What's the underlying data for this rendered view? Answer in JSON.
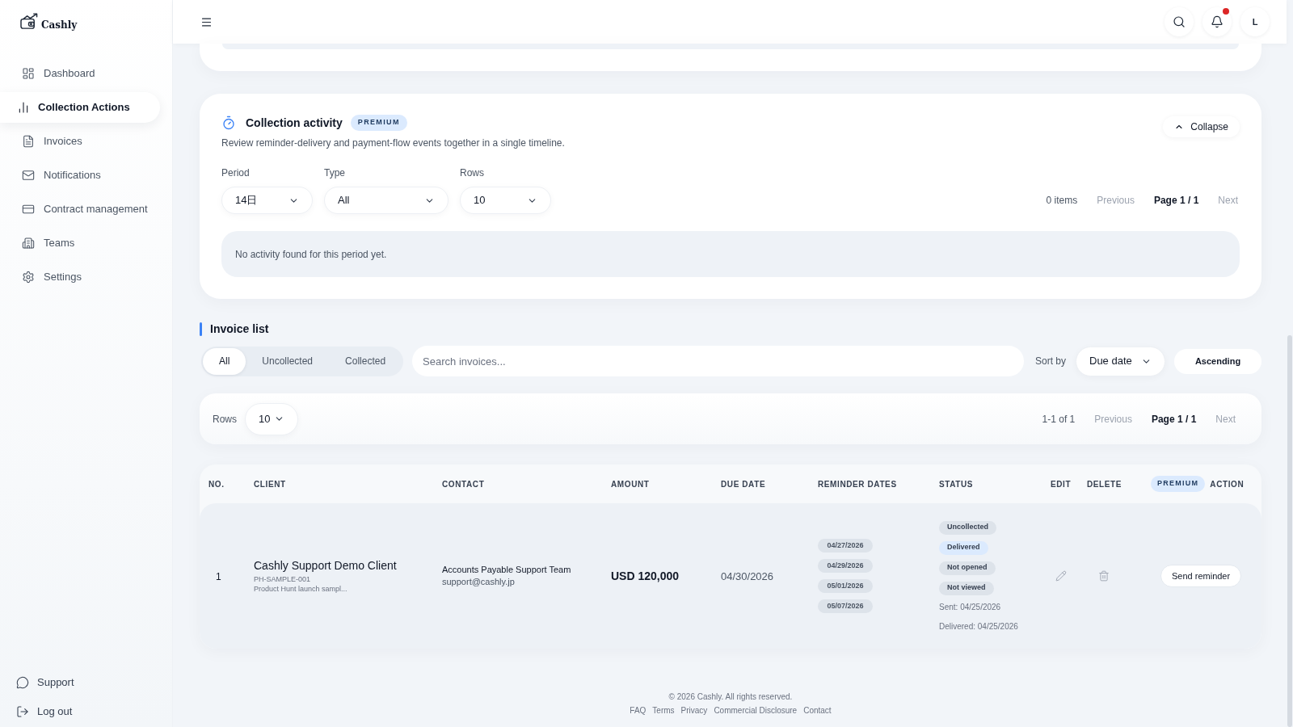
{
  "app": {
    "name": "Cashly"
  },
  "sidebar": {
    "items": [
      {
        "label": "Dashboard",
        "selected": false
      },
      {
        "label": "Collection Actions",
        "selected": true
      },
      {
        "label": "Invoices",
        "selected": false
      },
      {
        "label": "Notifications",
        "selected": false
      },
      {
        "label": "Contract management",
        "selected": false
      },
      {
        "label": "Teams",
        "selected": false
      },
      {
        "label": "Settings",
        "selected": false
      }
    ],
    "bottom_items": [
      {
        "label": "Support"
      },
      {
        "label": "Log out"
      }
    ]
  },
  "top_bar": {
    "notifications": {
      "unread": true
    },
    "avatar": "L"
  },
  "collection_activity": {
    "title": "Collection activity",
    "badge": "PREMIUM",
    "description": "Review reminder-delivery and payment-flow events together in a single timeline.",
    "collapse_button": "Collapse",
    "expanded": true,
    "filters": [
      {
        "label": "Period",
        "value": "14日"
      },
      {
        "label": "Type",
        "value": "All"
      },
      {
        "label": "Rows",
        "value": "10"
      }
    ],
    "count": "0 items",
    "pagination": {
      "previous": {
        "label": "Previous",
        "disabled": true
      },
      "page": "Page 1 / 1",
      "next": {
        "label": "Next",
        "disabled": true
      }
    },
    "empty_message": "No activity found for this period yet."
  },
  "invoice_list": {
    "title": "Invoice list",
    "tabs": [
      {
        "label": "All",
        "selected": true
      },
      {
        "label": "Uncollected",
        "selected": false
      },
      {
        "label": "Collected",
        "selected": false
      }
    ],
    "search": {
      "placeholder": "Search invoices..."
    },
    "sort": {
      "label": "Sort by",
      "value": "Due date",
      "order": "Ascending"
    },
    "rows": {
      "label": "Rows",
      "value": "10"
    },
    "range": "1-1 of 1",
    "pagination": {
      "previous": {
        "label": "Previous",
        "disabled": true
      },
      "page": "Page 1 / 1",
      "next": {
        "label": "Next",
        "disabled": true
      }
    }
  },
  "table": {
    "columns": [
      {
        "label": "NO."
      },
      {
        "label": "CLIENT"
      },
      {
        "label": "CONTACT"
      },
      {
        "label": "AMOUNT"
      },
      {
        "label": "DUE DATE"
      },
      {
        "label": "REMINDER DATES"
      },
      {
        "label": "STATUS"
      },
      {
        "label": "EDIT"
      },
      {
        "label": "DELETE"
      },
      {
        "label": "ACTION",
        "badge": "PREMIUM"
      }
    ],
    "rows": [
      {
        "no": "1",
        "client": {
          "name": "Cashly Support Demo Client",
          "code": "PH-SAMPLE-001",
          "note": "Product Hunt launch sampl..."
        },
        "contact": {
          "name": "Accounts Payable Support Team",
          "email": "support@cashly.jp"
        },
        "amount": "USD 120,000",
        "due_date": "04/30/2026",
        "reminder_dates": [
          "04/27/2026",
          "04/29/2026",
          "05/01/2026",
          "05/07/2026"
        ],
        "status": [
          {
            "label": "Uncollected",
            "color": "#dde3ea"
          },
          {
            "label": "Delivered",
            "color": "#dbeafe"
          },
          {
            "label": "Not opened",
            "color": "#dde3ea"
          },
          {
            "label": "Not viewed",
            "color": "#dde3ea"
          }
        ],
        "sent": "Sent: 04/25/2026",
        "delivered": "Delivered: 04/25/2026",
        "action": "Send reminder"
      }
    ]
  },
  "footer": {
    "copyright": "© 2026 Cashly. All rights reserved.",
    "links": [
      "FAQ",
      "Terms",
      "Privacy",
      "Commercial Disclosure",
      "Contact"
    ]
  }
}
